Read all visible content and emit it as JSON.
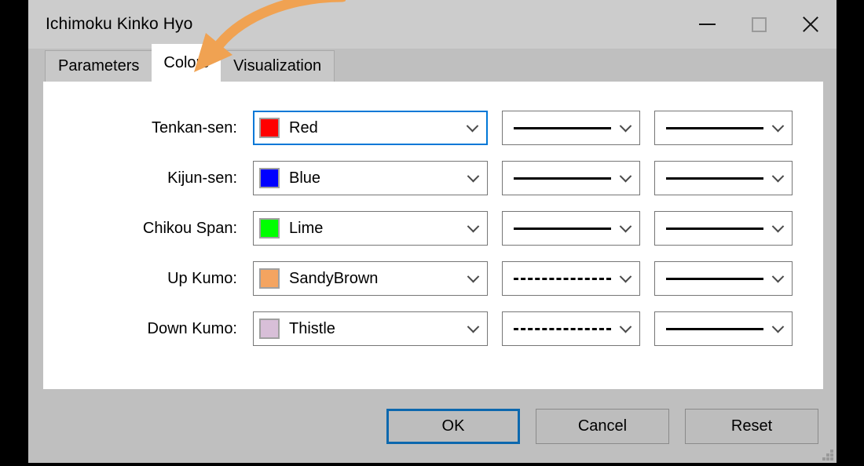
{
  "window": {
    "title": "Ichimoku Kinko Hyo",
    "controls": [
      {
        "name": "minimize",
        "glyph": "minimize-icon"
      },
      {
        "name": "maximize",
        "glyph": "maximize-icon"
      },
      {
        "name": "close",
        "glyph": "close-icon"
      }
    ]
  },
  "tabs": [
    {
      "label": "Parameters",
      "active": false
    },
    {
      "label": "Colors",
      "active": true
    },
    {
      "label": "Visualization",
      "active": false
    }
  ],
  "annotation": {
    "type": "curved-arrow",
    "color": "#F0A252",
    "points_to": "Colors"
  },
  "rows": [
    {
      "label": "Tenkan-sen:",
      "color_name": "Red",
      "color_hex": "#FF0000",
      "focused": true,
      "line_style": "solid",
      "width_style": "solid"
    },
    {
      "label": "Kijun-sen:",
      "color_name": "Blue",
      "color_hex": "#0000FF",
      "focused": false,
      "line_style": "solid",
      "width_style": "solid"
    },
    {
      "label": "Chikou Span:",
      "color_name": "Lime",
      "color_hex": "#00FF00",
      "focused": false,
      "line_style": "solid",
      "width_style": "solid"
    },
    {
      "label": "Up Kumo:",
      "color_name": "SandyBrown",
      "color_hex": "#F4A460",
      "focused": false,
      "line_style": "dashed",
      "width_style": "solid"
    },
    {
      "label": "Down Kumo:",
      "color_name": "Thistle",
      "color_hex": "#D8BFD8",
      "focused": false,
      "line_style": "dashed",
      "width_style": "solid"
    }
  ],
  "buttons": [
    {
      "label": "OK",
      "default": true
    },
    {
      "label": "Cancel",
      "default": false
    },
    {
      "label": "Reset",
      "default": false
    }
  ],
  "colors": {
    "accent": "#0078D7",
    "default_button_border": "#0C68AE",
    "titlebar_bg": "#CCCCCC",
    "dialog_bg": "#BFBFBF",
    "page_bg": "#FFFFFF",
    "combo_border": "#767676"
  }
}
